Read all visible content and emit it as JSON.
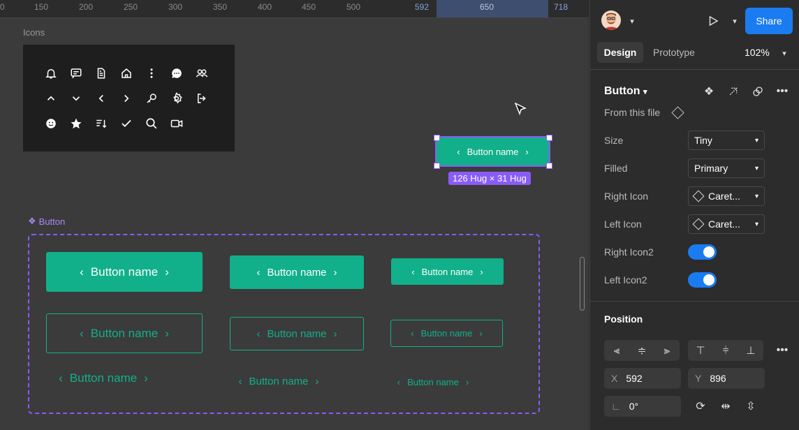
{
  "ruler": {
    "ticks": [
      "0",
      "150",
      "200",
      "250",
      "300",
      "350",
      "400",
      "450",
      "500",
      "592",
      "650",
      "718"
    ]
  },
  "canvas": {
    "icons_label": "Icons",
    "icons": [
      "bell-icon",
      "message-square-icon",
      "file-text-icon",
      "home-icon",
      "more-vertical-icon",
      "chat-bubble-icon",
      "users-icon",
      "chevron-up-icon",
      "chevron-down-icon",
      "chevron-left-icon",
      "chevron-right-icon",
      "key-icon",
      "settings-icon",
      "logout-icon",
      "emoji-icon",
      "star-icon",
      "sort-icon",
      "check-icon",
      "search-icon",
      "video-icon"
    ],
    "selected_button": {
      "label": "Button name",
      "size_badge": "126 Hug × 31 Hug"
    },
    "component_label": "Button",
    "variants": [
      {
        "style": "filled",
        "label": "Button name"
      },
      {
        "style": "filled",
        "label": "Button name"
      },
      {
        "style": "filled",
        "label": "Button name"
      },
      {
        "style": "outline",
        "label": "Button name"
      },
      {
        "style": "outline",
        "label": "Button name"
      },
      {
        "style": "outline",
        "label": "Button name"
      },
      {
        "style": "text",
        "label": "Button name"
      },
      {
        "style": "text",
        "label": "Button name"
      },
      {
        "style": "text",
        "label": "Button name"
      }
    ]
  },
  "header": {
    "share": "Share",
    "tabs": [
      "Design",
      "Prototype"
    ],
    "zoom": "102%"
  },
  "component": {
    "name": "Button",
    "source": "From this file"
  },
  "props": {
    "size_label": "Size",
    "size_value": "Tiny",
    "filled_label": "Filled",
    "filled_value": "Primary",
    "right_icon_label": "Right Icon",
    "right_icon_value": "Caret...",
    "left_icon_label": "Left Icon",
    "left_icon_value": "Caret...",
    "right_icon2_label": "Right Icon2",
    "right_icon2_on": true,
    "left_icon2_label": "Left Icon2",
    "left_icon2_on": true
  },
  "position": {
    "title": "Position",
    "x_label": "X",
    "x": "592",
    "y_label": "Y",
    "y": "896",
    "rotation": "0°"
  },
  "colors": {
    "accent": "#11b08a",
    "selection": "#8a5cf6",
    "primary_blue": "#1a7cf0"
  }
}
